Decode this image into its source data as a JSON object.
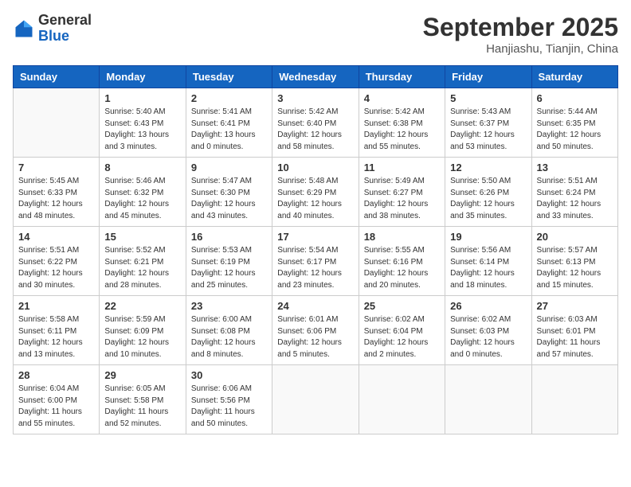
{
  "header": {
    "logo_general": "General",
    "logo_blue": "Blue",
    "month_title": "September 2025",
    "location": "Hanjiashu, Tianjin, China"
  },
  "days_of_week": [
    "Sunday",
    "Monday",
    "Tuesday",
    "Wednesday",
    "Thursday",
    "Friday",
    "Saturday"
  ],
  "weeks": [
    [
      {
        "day": "",
        "info": ""
      },
      {
        "day": "1",
        "info": "Sunrise: 5:40 AM\nSunset: 6:43 PM\nDaylight: 13 hours\nand 3 minutes."
      },
      {
        "day": "2",
        "info": "Sunrise: 5:41 AM\nSunset: 6:41 PM\nDaylight: 13 hours\nand 0 minutes."
      },
      {
        "day": "3",
        "info": "Sunrise: 5:42 AM\nSunset: 6:40 PM\nDaylight: 12 hours\nand 58 minutes."
      },
      {
        "day": "4",
        "info": "Sunrise: 5:42 AM\nSunset: 6:38 PM\nDaylight: 12 hours\nand 55 minutes."
      },
      {
        "day": "5",
        "info": "Sunrise: 5:43 AM\nSunset: 6:37 PM\nDaylight: 12 hours\nand 53 minutes."
      },
      {
        "day": "6",
        "info": "Sunrise: 5:44 AM\nSunset: 6:35 PM\nDaylight: 12 hours\nand 50 minutes."
      }
    ],
    [
      {
        "day": "7",
        "info": "Sunrise: 5:45 AM\nSunset: 6:33 PM\nDaylight: 12 hours\nand 48 minutes."
      },
      {
        "day": "8",
        "info": "Sunrise: 5:46 AM\nSunset: 6:32 PM\nDaylight: 12 hours\nand 45 minutes."
      },
      {
        "day": "9",
        "info": "Sunrise: 5:47 AM\nSunset: 6:30 PM\nDaylight: 12 hours\nand 43 minutes."
      },
      {
        "day": "10",
        "info": "Sunrise: 5:48 AM\nSunset: 6:29 PM\nDaylight: 12 hours\nand 40 minutes."
      },
      {
        "day": "11",
        "info": "Sunrise: 5:49 AM\nSunset: 6:27 PM\nDaylight: 12 hours\nand 38 minutes."
      },
      {
        "day": "12",
        "info": "Sunrise: 5:50 AM\nSunset: 6:26 PM\nDaylight: 12 hours\nand 35 minutes."
      },
      {
        "day": "13",
        "info": "Sunrise: 5:51 AM\nSunset: 6:24 PM\nDaylight: 12 hours\nand 33 minutes."
      }
    ],
    [
      {
        "day": "14",
        "info": "Sunrise: 5:51 AM\nSunset: 6:22 PM\nDaylight: 12 hours\nand 30 minutes."
      },
      {
        "day": "15",
        "info": "Sunrise: 5:52 AM\nSunset: 6:21 PM\nDaylight: 12 hours\nand 28 minutes."
      },
      {
        "day": "16",
        "info": "Sunrise: 5:53 AM\nSunset: 6:19 PM\nDaylight: 12 hours\nand 25 minutes."
      },
      {
        "day": "17",
        "info": "Sunrise: 5:54 AM\nSunset: 6:17 PM\nDaylight: 12 hours\nand 23 minutes."
      },
      {
        "day": "18",
        "info": "Sunrise: 5:55 AM\nSunset: 6:16 PM\nDaylight: 12 hours\nand 20 minutes."
      },
      {
        "day": "19",
        "info": "Sunrise: 5:56 AM\nSunset: 6:14 PM\nDaylight: 12 hours\nand 18 minutes."
      },
      {
        "day": "20",
        "info": "Sunrise: 5:57 AM\nSunset: 6:13 PM\nDaylight: 12 hours\nand 15 minutes."
      }
    ],
    [
      {
        "day": "21",
        "info": "Sunrise: 5:58 AM\nSunset: 6:11 PM\nDaylight: 12 hours\nand 13 minutes."
      },
      {
        "day": "22",
        "info": "Sunrise: 5:59 AM\nSunset: 6:09 PM\nDaylight: 12 hours\nand 10 minutes."
      },
      {
        "day": "23",
        "info": "Sunrise: 6:00 AM\nSunset: 6:08 PM\nDaylight: 12 hours\nand 8 minutes."
      },
      {
        "day": "24",
        "info": "Sunrise: 6:01 AM\nSunset: 6:06 PM\nDaylight: 12 hours\nand 5 minutes."
      },
      {
        "day": "25",
        "info": "Sunrise: 6:02 AM\nSunset: 6:04 PM\nDaylight: 12 hours\nand 2 minutes."
      },
      {
        "day": "26",
        "info": "Sunrise: 6:02 AM\nSunset: 6:03 PM\nDaylight: 12 hours\nand 0 minutes."
      },
      {
        "day": "27",
        "info": "Sunrise: 6:03 AM\nSunset: 6:01 PM\nDaylight: 11 hours\nand 57 minutes."
      }
    ],
    [
      {
        "day": "28",
        "info": "Sunrise: 6:04 AM\nSunset: 6:00 PM\nDaylight: 11 hours\nand 55 minutes."
      },
      {
        "day": "29",
        "info": "Sunrise: 6:05 AM\nSunset: 5:58 PM\nDaylight: 11 hours\nand 52 minutes."
      },
      {
        "day": "30",
        "info": "Sunrise: 6:06 AM\nSunset: 5:56 PM\nDaylight: 11 hours\nand 50 minutes."
      },
      {
        "day": "",
        "info": ""
      },
      {
        "day": "",
        "info": ""
      },
      {
        "day": "",
        "info": ""
      },
      {
        "day": "",
        "info": ""
      }
    ]
  ]
}
